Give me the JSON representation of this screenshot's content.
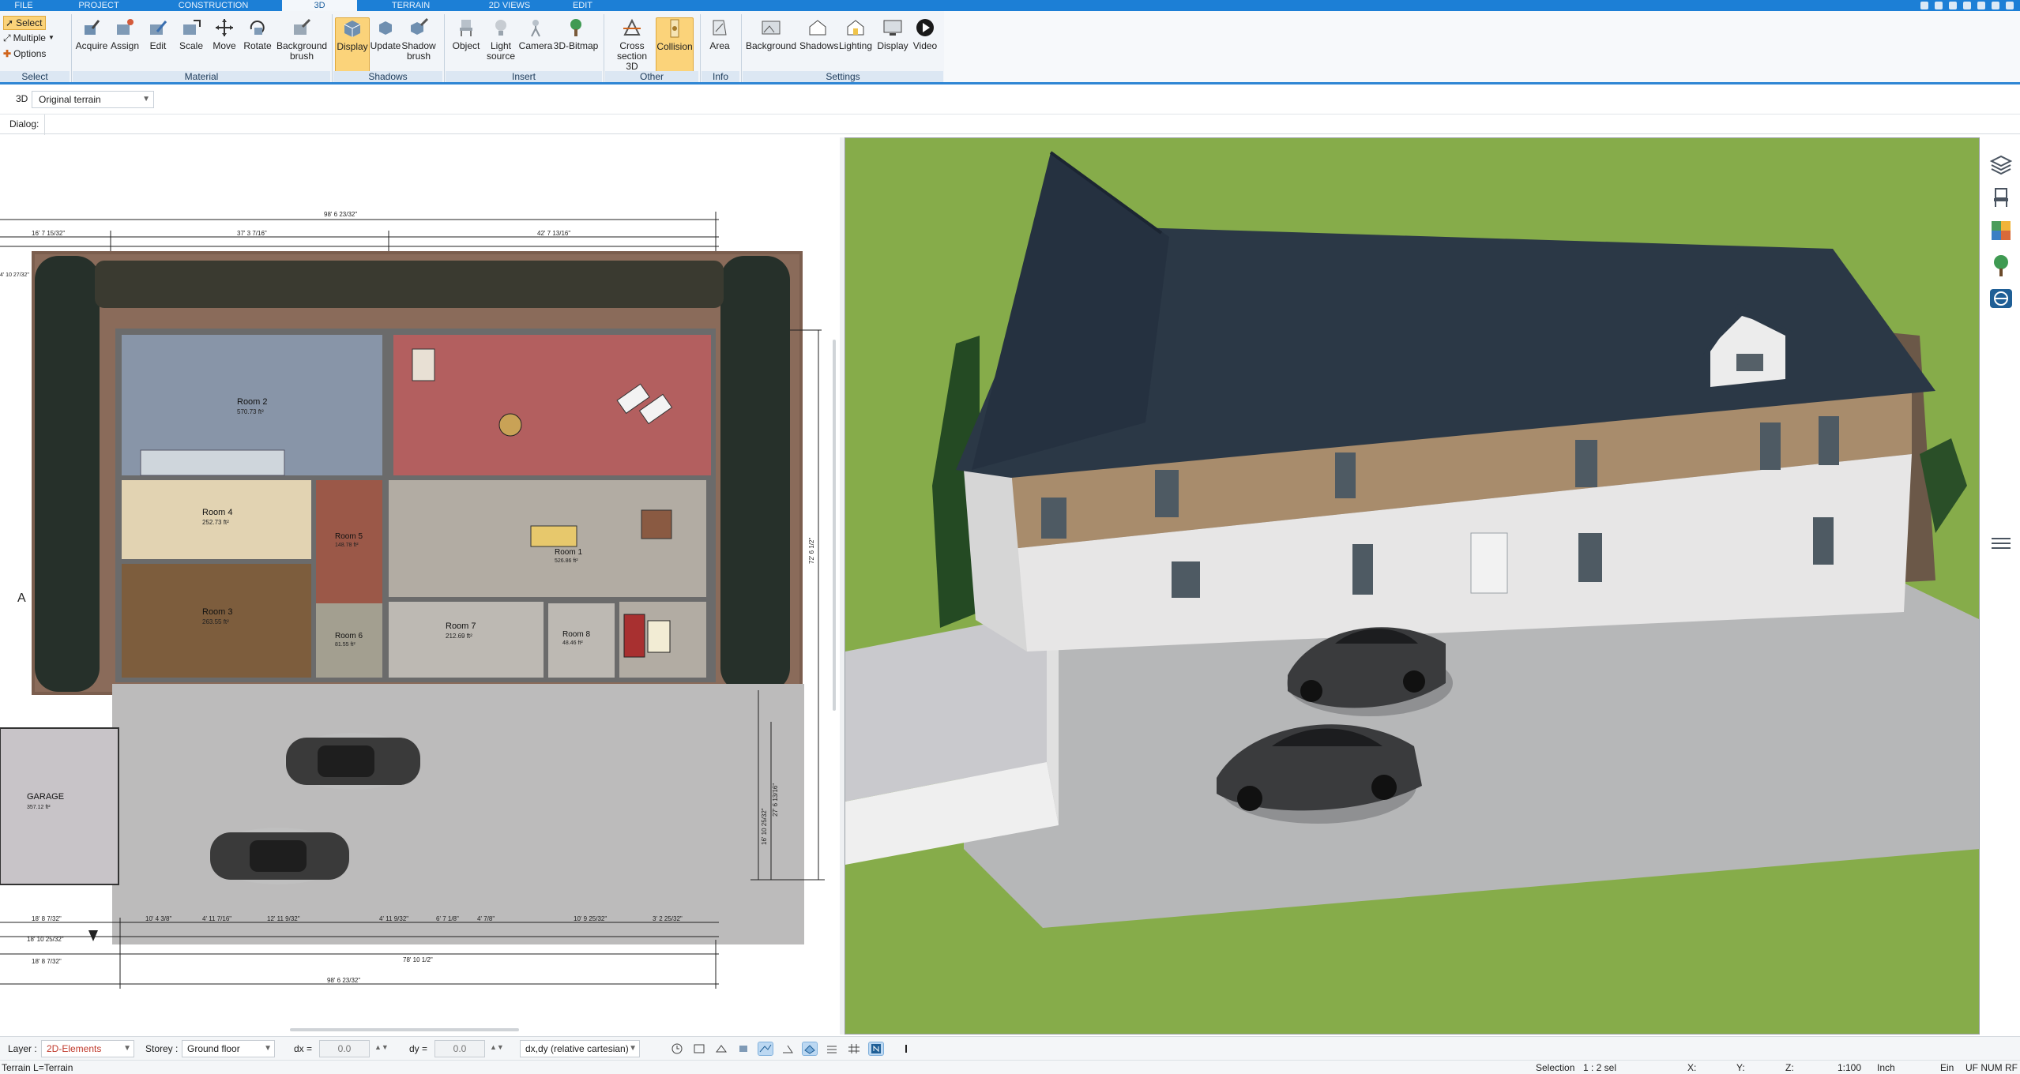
{
  "menu_tabs": [
    "FILE",
    "PROJECT",
    "CONSTRUCTION",
    "3D",
    "TERRAIN",
    "2D VIEWS",
    "EDIT"
  ],
  "active_tab": "3D",
  "ribbon": {
    "select_group": {
      "select": "Select",
      "multiple": "Multiple",
      "options": "Options",
      "label": "Select"
    },
    "material_group": {
      "label": "Material",
      "buttons": [
        "Acquire",
        "Assign",
        "Edit",
        "Scale",
        "Move",
        "Rotate",
        "Background brush"
      ]
    },
    "shadows_group": {
      "label": "Shadows",
      "buttons": [
        "Display",
        "Update",
        "Shadow brush"
      ]
    },
    "insert_group": {
      "label": "Insert",
      "buttons": [
        "Object",
        "Light source",
        "Camera",
        "3D-Bitmap"
      ]
    },
    "other_group": {
      "label": "Other",
      "buttons": [
        "Cross section 3D",
        "Collision"
      ]
    },
    "info_group": {
      "label": "Info",
      "buttons": [
        "Area"
      ]
    },
    "settings_group": {
      "label": "Settings",
      "buttons": [
        "Background",
        "Shadows",
        "Lighting",
        "Display",
        "Video"
      ]
    }
  },
  "options": {
    "mode_label": "3D",
    "terrain_value": "Original terrain",
    "dialog_label": "Dialog:"
  },
  "plan": {
    "rooms": [
      {
        "name": "Room 2",
        "area": "570.73 ft²"
      },
      {
        "name": "Room 4",
        "area": "252.73 ft²"
      },
      {
        "name": "Room 3",
        "area": "263.55 ft²"
      },
      {
        "name": "Room 1",
        "area": "526.86 ft²"
      },
      {
        "name": "Room 5",
        "area": "148.78 ft²"
      },
      {
        "name": "Room 6",
        "area": "81.55 ft²"
      },
      {
        "name": "Room 7",
        "area": "212.69 ft²"
      },
      {
        "name": "Room 8",
        "area": "48.46 ft²"
      },
      {
        "name": "GARAGE",
        "area": "357.12 ft²"
      }
    ],
    "dimensions_top": [
      "98' 6 23/32\"",
      "16' 7 15/32\"",
      "37' 3 7/16\"",
      "42' 7 13/16\""
    ],
    "dimensions_bottom": [
      "18' 8 7/32\"",
      "10' 4 3/8\"",
      "4' 11 7/16\"",
      "12' 11 9/32\"",
      "4' 11 9/32\"",
      "6' 7 1/8\"",
      "4' 7/8\"",
      "10' 9 25/32\"",
      "3' 2 25/32\"",
      "18' 10 25/32\"",
      "18' 8 7/32\"",
      "78' 10 1/2\"",
      "98' 6 23/32\""
    ],
    "dimensions_right": [
      "72' 6 1/2\"",
      "27' 6 13/16\"",
      "16' 10 25/32\""
    ],
    "side_label": "A",
    "corner_label": "4' 10 27/32\""
  },
  "bottom_bar": {
    "layer_label": "Layer :",
    "layer_value": "2D-Elements",
    "storey_label": "Storey :",
    "storey_value": "Ground floor",
    "dx_label": "dx =",
    "dx_value": "0.0",
    "dy_label": "dy =",
    "dy_value": "0.0",
    "coord_mode": "dx,dy (relative cartesian)"
  },
  "status_bar": {
    "left": "Terrain L=Terrain",
    "selection": "Selection",
    "selection_value": "1 : 2 sel",
    "x": "X:",
    "y": "Y:",
    "z": "Z:",
    "scale": "1:100",
    "unit": "Inch",
    "ein": "Ein",
    "flags": "UF NUM RF"
  },
  "colors": {
    "accent": "#1c7fd6",
    "selected": "#fbd37a",
    "roof": "#2a3745",
    "grass": "#8ab34c",
    "paving": "#b9babc",
    "room_red": "#b85c5c",
    "room_blue": "#8c9aae"
  },
  "icons": {
    "side_tools": [
      "layers-icon",
      "chair-icon",
      "texture-icon",
      "tree-icon",
      "view-toggle-icon"
    ]
  }
}
